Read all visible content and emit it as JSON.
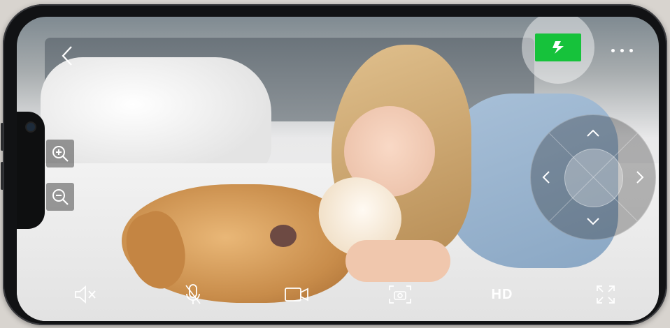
{
  "toolbar": {
    "hd_label": "HD"
  },
  "icons": {
    "back": "chevron-left-icon",
    "flash": "lightning-icon",
    "more": "more-dots-icon",
    "zoom_in": "zoom-in-icon",
    "zoom_out": "zoom-out-icon",
    "dpad_up": "chevron-up-icon",
    "dpad_down": "chevron-down-icon",
    "dpad_left": "chevron-left-icon",
    "dpad_right": "chevron-right-icon",
    "mute": "speaker-muted-icon",
    "mic": "microphone-icon",
    "record": "video-camera-icon",
    "snapshot": "camera-capture-icon",
    "fullscreen": "fullscreen-icon"
  },
  "colors": {
    "flash_active": "#16c23b",
    "overlay_icon": "#ffffff"
  }
}
